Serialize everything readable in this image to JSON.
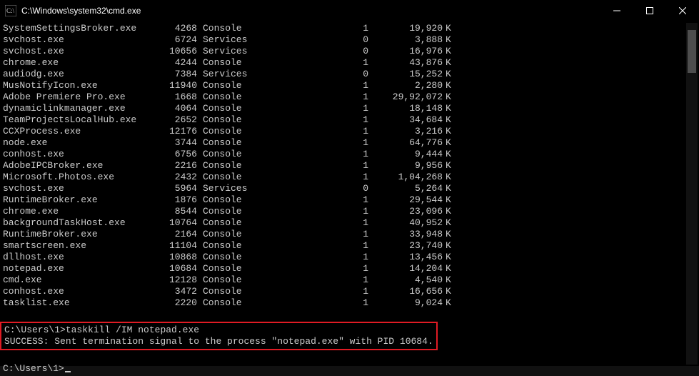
{
  "window": {
    "title": "C:\\Windows\\system32\\cmd.exe"
  },
  "processes": [
    {
      "name": "SystemSettingsBroker.exe",
      "pid": "4268",
      "session": "Console",
      "snum": "1",
      "mem": "19,920"
    },
    {
      "name": "svchost.exe",
      "pid": "6724",
      "session": "Services",
      "snum": "0",
      "mem": "3,888"
    },
    {
      "name": "svchost.exe",
      "pid": "10656",
      "session": "Services",
      "snum": "0",
      "mem": "16,976"
    },
    {
      "name": "chrome.exe",
      "pid": "4244",
      "session": "Console",
      "snum": "1",
      "mem": "43,876"
    },
    {
      "name": "audiodg.exe",
      "pid": "7384",
      "session": "Services",
      "snum": "0",
      "mem": "15,252"
    },
    {
      "name": "MusNotifyIcon.exe",
      "pid": "11940",
      "session": "Console",
      "snum": "1",
      "mem": "2,280"
    },
    {
      "name": "Adobe Premiere Pro.exe",
      "pid": "1668",
      "session": "Console",
      "snum": "1",
      "mem": "29,92,072"
    },
    {
      "name": "dynamiclinkmanager.exe",
      "pid": "4064",
      "session": "Console",
      "snum": "1",
      "mem": "18,148"
    },
    {
      "name": "TeamProjectsLocalHub.exe",
      "pid": "2652",
      "session": "Console",
      "snum": "1",
      "mem": "34,684"
    },
    {
      "name": "CCXProcess.exe",
      "pid": "12176",
      "session": "Console",
      "snum": "1",
      "mem": "3,216"
    },
    {
      "name": "node.exe",
      "pid": "3744",
      "session": "Console",
      "snum": "1",
      "mem": "64,776"
    },
    {
      "name": "conhost.exe",
      "pid": "6756",
      "session": "Console",
      "snum": "1",
      "mem": "9,444"
    },
    {
      "name": "AdobeIPCBroker.exe",
      "pid": "2216",
      "session": "Console",
      "snum": "1",
      "mem": "9,956"
    },
    {
      "name": "Microsoft.Photos.exe",
      "pid": "2432",
      "session": "Console",
      "snum": "1",
      "mem": "1,04,268"
    },
    {
      "name": "svchost.exe",
      "pid": "5964",
      "session": "Services",
      "snum": "0",
      "mem": "5,264"
    },
    {
      "name": "RuntimeBroker.exe",
      "pid": "1876",
      "session": "Console",
      "snum": "1",
      "mem": "29,544"
    },
    {
      "name": "chrome.exe",
      "pid": "8544",
      "session": "Console",
      "snum": "1",
      "mem": "23,096"
    },
    {
      "name": "backgroundTaskHost.exe",
      "pid": "10764",
      "session": "Console",
      "snum": "1",
      "mem": "40,952"
    },
    {
      "name": "RuntimeBroker.exe",
      "pid": "2164",
      "session": "Console",
      "snum": "1",
      "mem": "33,948"
    },
    {
      "name": "smartscreen.exe",
      "pid": "11104",
      "session": "Console",
      "snum": "1",
      "mem": "23,740"
    },
    {
      "name": "dllhost.exe",
      "pid": "10868",
      "session": "Console",
      "snum": "1",
      "mem": "13,456"
    },
    {
      "name": "notepad.exe",
      "pid": "10684",
      "session": "Console",
      "snum": "1",
      "mem": "14,204"
    },
    {
      "name": "cmd.exe",
      "pid": "12128",
      "session": "Console",
      "snum": "1",
      "mem": "4,540"
    },
    {
      "name": "conhost.exe",
      "pid": "3472",
      "session": "Console",
      "snum": "1",
      "mem": "16,656"
    },
    {
      "name": "tasklist.exe",
      "pid": "2220",
      "session": "Console",
      "snum": "1",
      "mem": "9,024"
    }
  ],
  "mem_unit": "K",
  "cmd": {
    "prompt1": "C:\\Users\\1>",
    "command": "taskkill /IM notepad.exe",
    "result": "SUCCESS: Sent termination signal to the process \"notepad.exe\" with PID 10684.",
    "prompt2": "C:\\Users\\1>"
  }
}
